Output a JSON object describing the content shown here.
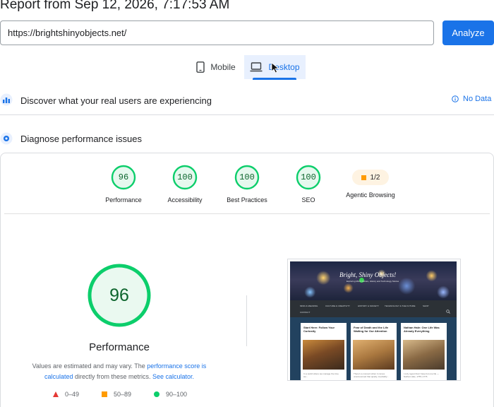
{
  "header": {
    "title": "Report from Sep 12, 2026, 7:17:53 AM",
    "url_value": "https://brightshinyobjects.net/",
    "analyze_label": "Analyze"
  },
  "tabs": {
    "mobile_label": "Mobile",
    "desktop_label": "Desktop",
    "selected": "Desktop"
  },
  "sections": {
    "discover_text": "Discover what your real users are experiencing",
    "no_data_label": "No Data",
    "diagnose_text": "Diagnose performance issues"
  },
  "categories": [
    {
      "label": "Performance",
      "score": "96"
    },
    {
      "label": "Accessibility",
      "score": "100"
    },
    {
      "label": "Best Practices",
      "score": "100"
    },
    {
      "label": "SEO",
      "score": "100"
    },
    {
      "label": "Agentic Browsing",
      "score": "1/2"
    }
  ],
  "main": {
    "score": "96",
    "label": "Performance",
    "disclaimer_pre": "Values are estimated and may vary. The ",
    "disclaimer_link1": "performance score is calculated",
    "disclaimer_mid": " directly from these metrics. ",
    "disclaimer_link2": "See calculator."
  },
  "legend": {
    "fail": "0–49",
    "average": "50–89",
    "pass": "90–100"
  },
  "thumbnail": {
    "site_title": "Bright, Shiny Objects!",
    "site_subtitle": "Exploring Mind, Culture, History and Technology Stories",
    "nav_items": [
      "MIND & MEANING",
      "CULTURE & CREATIVITY",
      "HISTORY & SOCIETY",
      "TECHNOLOGY & THE FUTURE",
      "SHOP",
      "CONTACT"
    ],
    "posts": [
      {
        "title": "Start Here: Follow Your Curiosity",
        "text": "In a world where we manage the time we..."
      },
      {
        "title": "Fear of Death and the Life Waiting for Our Attention",
        "text": "There's a moment when it comes unannounced that quietly, inevitably..."
      },
      {
        "title": "Nathan Hale: One Life Was Already Everything",
        "text": "I only regret that I have but one life — Nathan Hale, 1755–1776"
      }
    ]
  },
  "colors": {
    "accent": "#1a73e8",
    "pass": "#0cce6b",
    "average": "#ff9b00",
    "fail": "#e53935"
  }
}
